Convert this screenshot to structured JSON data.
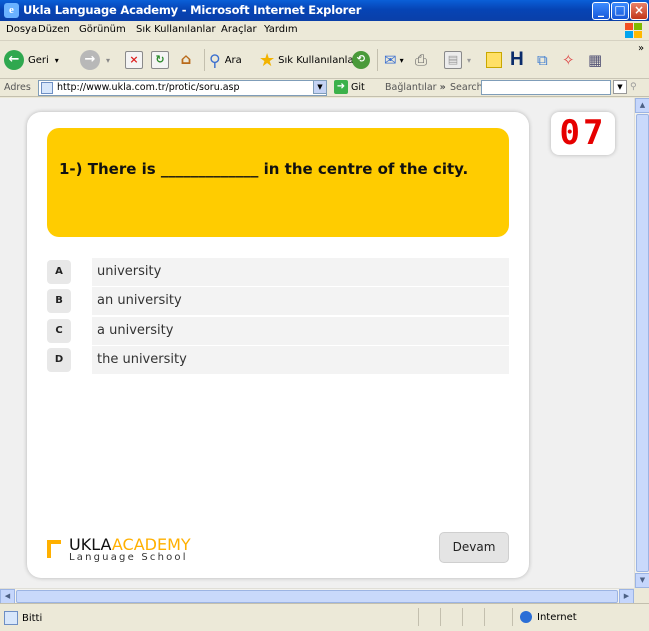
{
  "window": {
    "title": "Ukla Language Academy - Microsoft Internet Explorer",
    "icon": "ie-icon"
  },
  "menu": [
    "Dosya",
    "Düzen",
    "Görünüm",
    "Sık Kullanılanlar",
    "Araçlar",
    "Yardım"
  ],
  "toolbar": {
    "back_label": "Geri",
    "search_label": "Ara",
    "favorites_label": "Sık Kullanılanlar"
  },
  "address": {
    "label": "Adres",
    "url": "http://www.ukla.com.tr/protic/soru.asp",
    "go_label": "Git",
    "links_label": "Bağlantılar",
    "links_more": "»",
    "search_label": "Search"
  },
  "quiz": {
    "question": "1-) There is _____________ in the centre of the city.",
    "options": [
      {
        "letter": "A",
        "text": "university"
      },
      {
        "letter": "B",
        "text": "an university"
      },
      {
        "letter": "C",
        "text": "a university"
      },
      {
        "letter": "D",
        "text": "the university"
      }
    ],
    "counter": "07",
    "continue_label": "Devam"
  },
  "brand": {
    "name_part1": "UKLA",
    "name_part2": "ACADEMY",
    "tagline": "Language School",
    "accent_color": "#ffb000",
    "question_bg": "#ffcc00",
    "counter_color": "#e60000"
  },
  "status": {
    "text": "Bitti",
    "zone": "Internet"
  }
}
